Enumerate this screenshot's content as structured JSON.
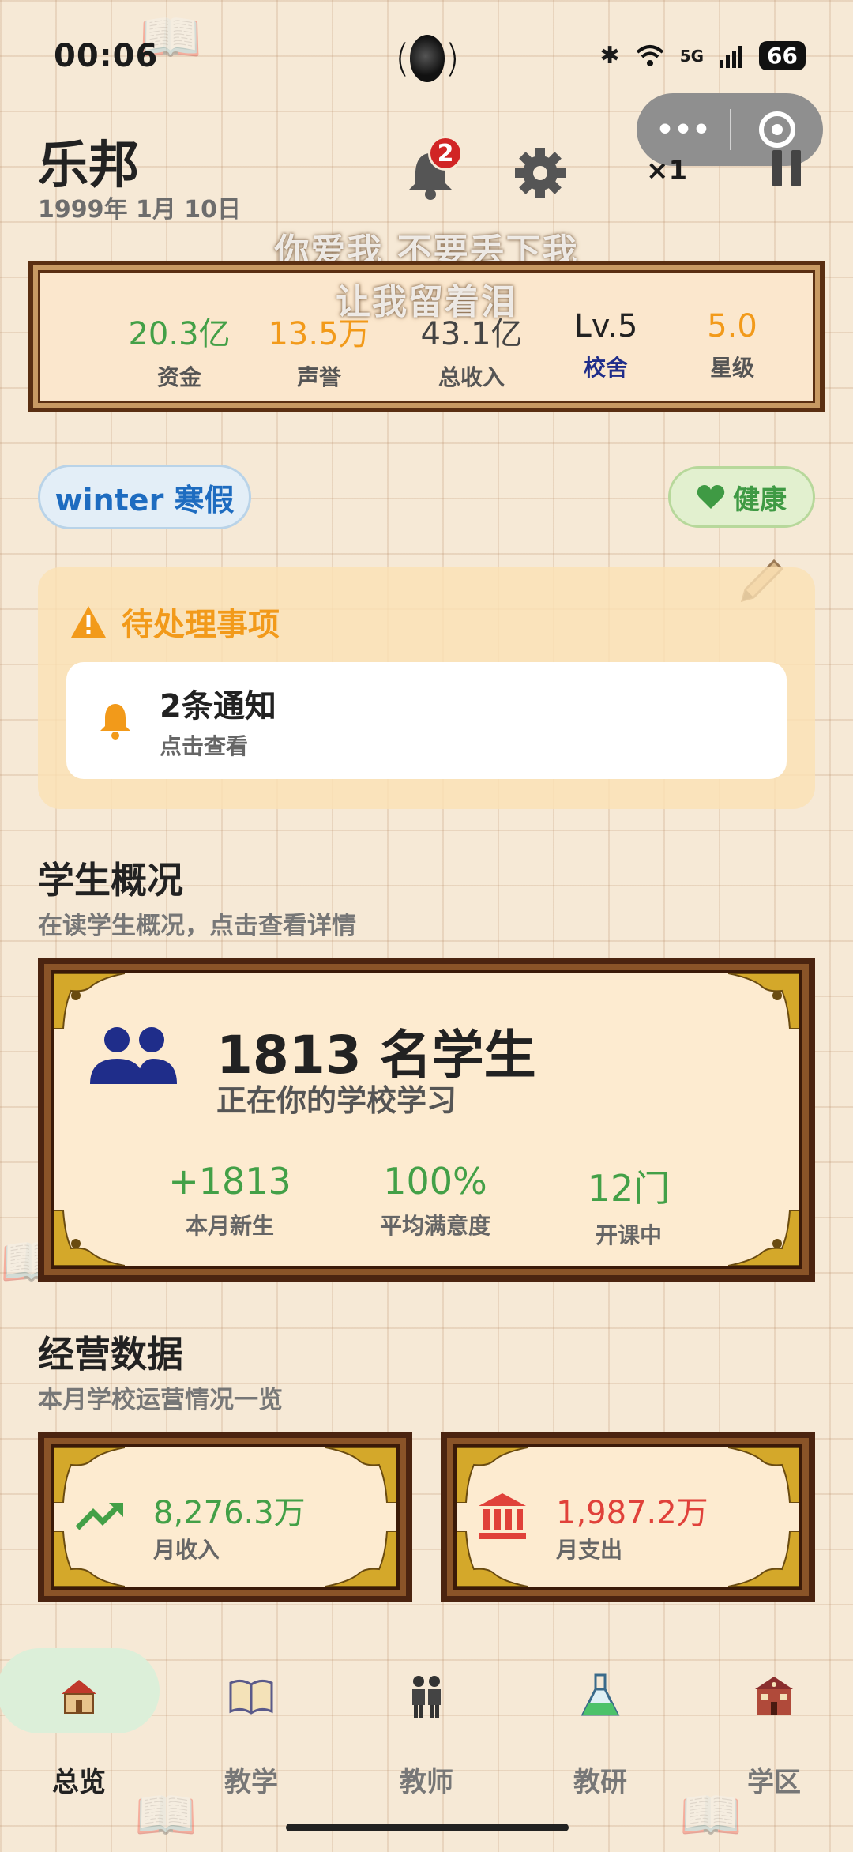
{
  "status_bar": {
    "time": "00:06",
    "battery": "66",
    "signal": "5G"
  },
  "header": {
    "school_name": "乐邦",
    "date": "1999年 1月 10日",
    "notification_count": "2",
    "speed": "×1"
  },
  "lyrics": {
    "line1": "你爱我 不要丢下我",
    "line2": "让我留着泪"
  },
  "stats": [
    {
      "value": "20.3亿",
      "label": "资金",
      "color": "#43a047"
    },
    {
      "value": "13.5万",
      "label": "声誉",
      "color": "#f29a1a"
    },
    {
      "value": "43.1亿",
      "label": "总收入",
      "color": "#444444"
    },
    {
      "value": "Lv.5",
      "label": "校舍",
      "color": "#222222",
      "label_color": "#1f2d8a"
    },
    {
      "value": "5.0",
      "label": "星级",
      "color": "#f29a1a"
    }
  ],
  "season": "winter 寒假",
  "health": "健康",
  "pending": {
    "title": "待处理事项",
    "item_title": "2条通知",
    "item_sub": "点击查看"
  },
  "students_section": {
    "title": "学生概况",
    "subtitle": "在读学生概况，点击查看详情",
    "count": "1813 名学生",
    "desc": "正在你的学校学习",
    "metrics": [
      {
        "value": "+1813",
        "label": "本月新生"
      },
      {
        "value": "100%",
        "label": "平均满意度"
      },
      {
        "value": "12门",
        "label": "开课中"
      }
    ]
  },
  "ops_section": {
    "title": "经营数据",
    "subtitle": "本月学校运营情况一览",
    "income": {
      "value": "8,276.3万",
      "label": "月收入",
      "color": "#43a047"
    },
    "expense": {
      "value": "1,987.2万",
      "label": "月支出",
      "color": "#e0413a"
    }
  },
  "tabs": [
    {
      "label": "总览",
      "icon": "school-house-icon",
      "active": true
    },
    {
      "label": "教学",
      "icon": "book-icon"
    },
    {
      "label": "教师",
      "icon": "teachers-icon"
    },
    {
      "label": "教研",
      "icon": "flask-icon"
    },
    {
      "label": "学区",
      "icon": "campus-building-icon"
    }
  ]
}
